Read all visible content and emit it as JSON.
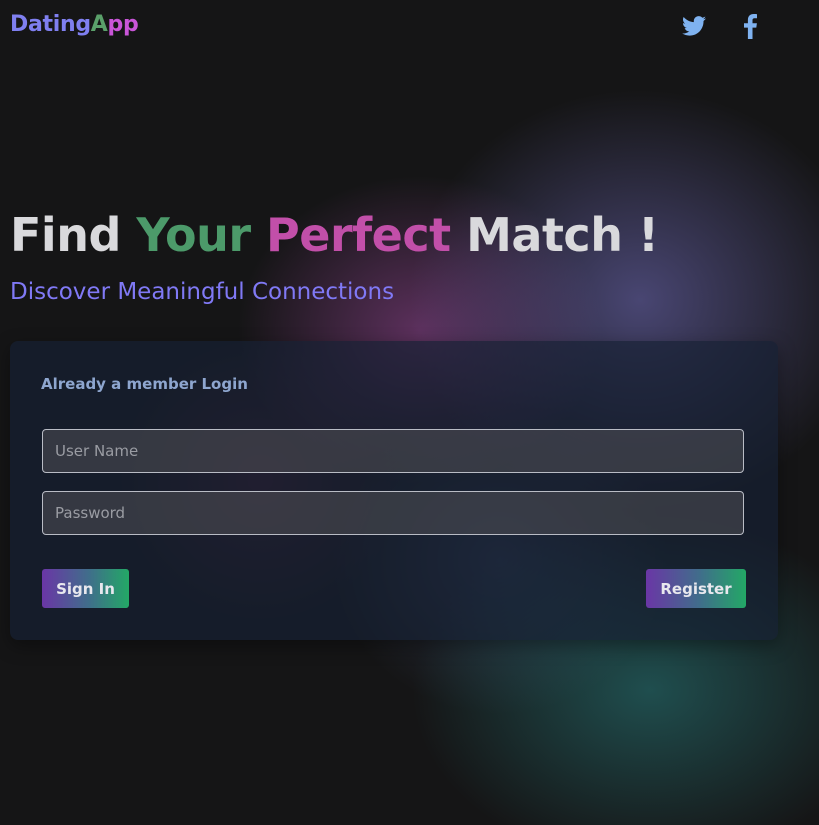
{
  "brand": {
    "logo_part1": "Dating",
    "logo_part2": "A",
    "logo_part3": "pp"
  },
  "header": {
    "social_icons": [
      "twitter-icon",
      "facebook-icon"
    ]
  },
  "hero": {
    "title_word1": "Find",
    "title_word2": "Your",
    "title_word3": "Perfect",
    "title_word4": "Match !",
    "subtitle": "Discover Meaningful Connections"
  },
  "login": {
    "heading": "Already a member Login",
    "username_placeholder": "User Name",
    "username_value": "",
    "password_placeholder": "Password",
    "password_value": "",
    "signin_label": "Sign In",
    "register_label": "Register"
  },
  "colors": {
    "background": "#151516",
    "logo_blue": "#7f7ff0",
    "logo_green": "#5aa06a",
    "logo_pink": "#c955d8",
    "title_green": "#4c9a6a",
    "title_pink": "#c24fa9",
    "subtitle": "#8079f5",
    "card_heading": "#8ea6cf",
    "social_icon": "#7fb2f0",
    "button_gradient_start": "#6a36a6",
    "button_gradient_end": "#23a866"
  }
}
